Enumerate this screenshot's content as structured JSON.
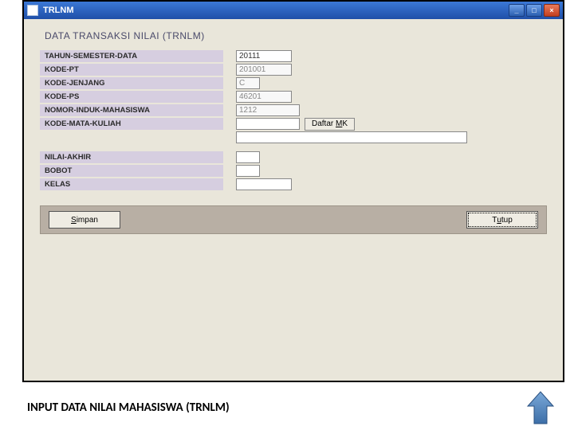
{
  "titlebar": {
    "title": "TRLNM"
  },
  "form": {
    "title": "DATA TRANSAKSI NILAI (TRNLM)",
    "labels": {
      "thsms": "TAHUN-SEMESTER-DATA",
      "kodept": "KODE-PT",
      "kodejenjang": "KODE-JENJANG",
      "kodeps": "KODE-PS",
      "nim": "NOMOR-INDUK-MAHASISWA",
      "kodemk": "KODE-MATA-KULIAH",
      "nilai": "NILAI-AKHIR",
      "bobot": "BOBOT",
      "kelas": "KELAS"
    },
    "values": {
      "thsms": "20111",
      "kodept": "201001",
      "kodejenjang": "C",
      "kodeps": "46201",
      "nim": "1212",
      "kodemk": "",
      "kodemk_name": "",
      "nilai": "",
      "bobot": "",
      "kelas": ""
    },
    "buttons": {
      "daftar_prefix": "Daftar ",
      "daftar_u": "M",
      "daftar_suffix": "K",
      "simpan_u": "S",
      "simpan_suffix": "impan",
      "tutup_prefix": "T",
      "tutup_u": "u",
      "tutup_suffix": "tup"
    }
  },
  "caption": "INPUT DATA NILAI MAHASISWA (TRNLM)"
}
